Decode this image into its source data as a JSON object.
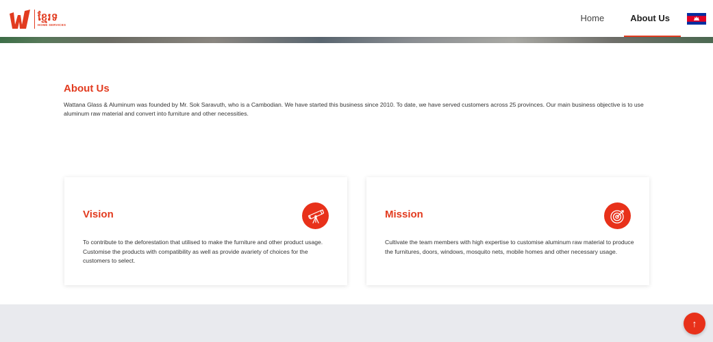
{
  "brand": {
    "logo_khmer": "ខ្មែរទ",
    "logo_sub": "HOME SERVICES",
    "accent_color": "#e23b1f"
  },
  "nav": {
    "items": [
      {
        "label": "Home"
      },
      {
        "label": "About Us"
      }
    ],
    "language_flag": "cambodia-flag-icon"
  },
  "about": {
    "title": "About Us",
    "text": "Wattana Glass & Aluminum was founded by Mr. Sok Saravuth, who is a Cambodian. We have started this business since 2010. To date, we have served customers across 25 provinces. Our main business objective is to use aluminum raw material and convert into furniture and other necessities."
  },
  "cards": {
    "vision": {
      "title": "Vision",
      "icon": "telescope-icon",
      "text": "To contribute to the deforestation that utilised to make the furniture and other product usage. Customise the products with compatibility as well as provide avariety of choices for the customers to select."
    },
    "mission": {
      "title": "Mission",
      "icon": "target-icon",
      "text": "Cultivate the team members with high expertise to customise aluminum raw material to produce the furnitures, doors, windows, mosquito nets, mobile homes and other necessary usage."
    }
  },
  "scroll_top": {
    "label": "↑"
  }
}
